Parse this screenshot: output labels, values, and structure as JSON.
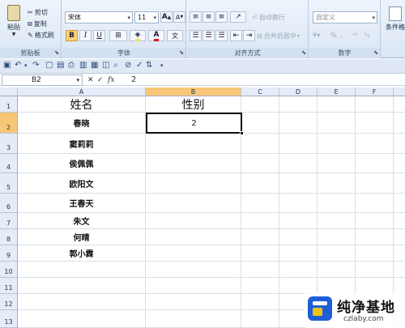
{
  "ribbon": {
    "clipboard": {
      "paste": "粘贴",
      "cut": "剪切",
      "copy": "复制",
      "format_painter": "格式刷",
      "group_label": "剪贴板"
    },
    "font": {
      "name": "宋体",
      "size": "11",
      "bold": "B",
      "italic": "I",
      "underline": "U",
      "font_color": "A",
      "wen": "文",
      "grow": "A",
      "shrink": "A",
      "group_label": "字体"
    },
    "alignment": {
      "wrap_text": "自动换行",
      "merge_center": "合并后居中",
      "group_label": "对齐方式"
    },
    "number": {
      "format": "自定义",
      "percent": "%",
      "comma": ",",
      "group_label": "数字"
    },
    "styles": {
      "conditional": "条件格"
    }
  },
  "formula_bar": {
    "name_box": "B2",
    "fx": "fx",
    "value": "2"
  },
  "sheet": {
    "columns": [
      "A",
      "B",
      "C",
      "D",
      "E",
      "F"
    ],
    "rows": [
      "1",
      "2",
      "3",
      "4",
      "5",
      "6",
      "7",
      "8",
      "9",
      "10",
      "11",
      "12",
      "13"
    ],
    "header": {
      "a1": "姓名",
      "b1": "性别"
    },
    "names": [
      "春晓",
      "窦莉莉",
      "侯佩佩",
      "欧阳文",
      "王春天",
      "朱文",
      "何晴",
      "郭小霖"
    ],
    "b2": "2"
  },
  "watermark": {
    "title": "纯净基地",
    "url": "czlaby.com"
  },
  "colors": {
    "selected_header": "#f7c777",
    "ribbon_bg": "#dbe6f4",
    "logo_blue": "#1f5fd6"
  }
}
